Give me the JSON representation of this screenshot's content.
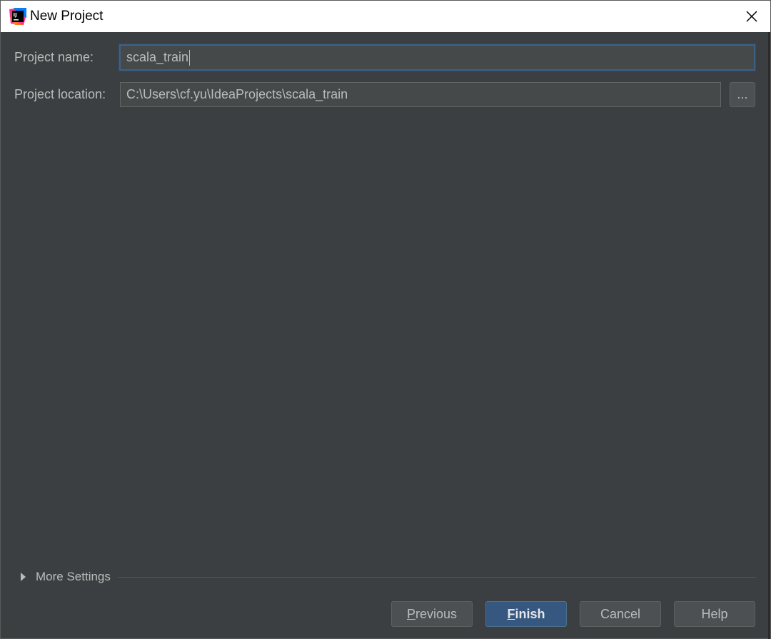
{
  "window": {
    "title": "New Project",
    "app_icon_text": "IJ"
  },
  "form": {
    "project_name_label": "Project name:",
    "project_name_value": "scala_train",
    "project_location_label": "Project location:",
    "project_location_value": "C:\\Users\\cf.yu\\IdeaProjects\\scala_train",
    "browse_label": "..."
  },
  "more_settings": {
    "label": "More Settings",
    "expanded": false
  },
  "buttons": {
    "previous": {
      "mnemonic": "P",
      "rest": "revious"
    },
    "finish": {
      "mnemonic": "F",
      "rest": "inish"
    },
    "cancel": "Cancel",
    "help": "Help"
  },
  "colors": {
    "background": "#3c3f41",
    "primary_button": "#365880",
    "focus_border": "#3d6185"
  }
}
